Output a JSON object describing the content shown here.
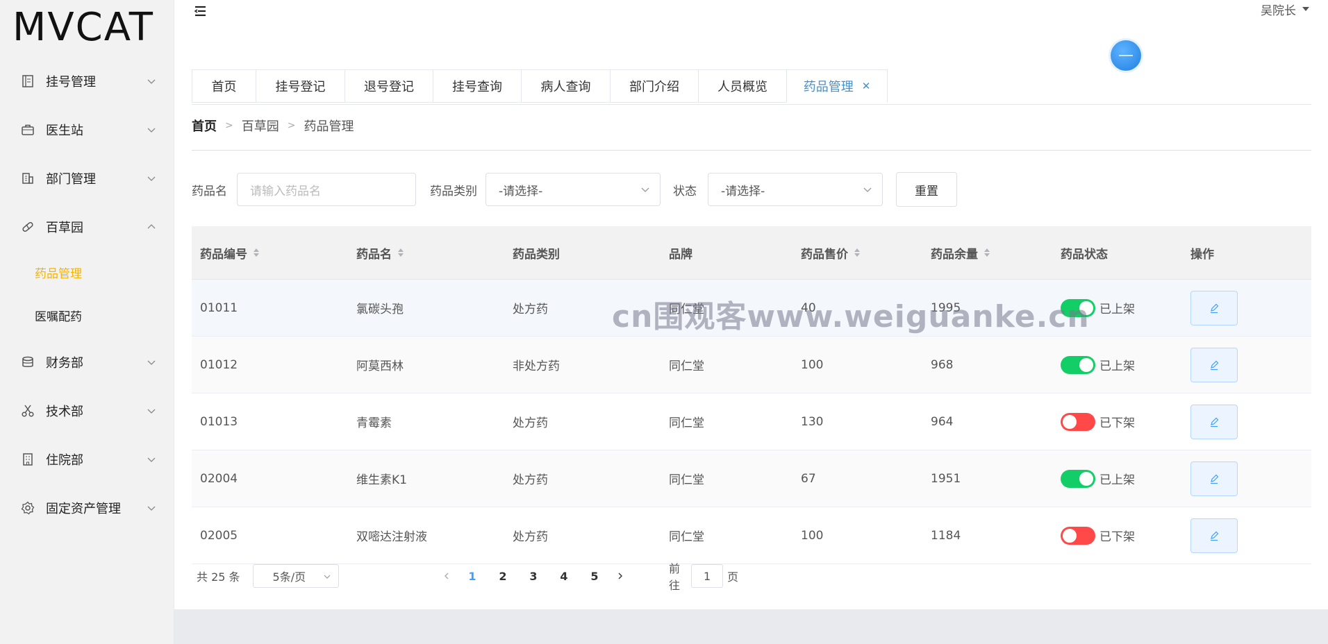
{
  "logo": "MVCAT",
  "sidebar": {
    "items": [
      {
        "label": "挂号管理",
        "icon": "document-icon"
      },
      {
        "label": "医生站",
        "icon": "briefcase-icon"
      },
      {
        "label": "部门管理",
        "icon": "building-icon"
      },
      {
        "label": "百草园",
        "icon": "medicine-icon",
        "expanded": true,
        "children": [
          {
            "label": "药品管理",
            "active": true
          },
          {
            "label": "医嘱配药"
          }
        ]
      },
      {
        "label": "财务部",
        "icon": "coins-icon"
      },
      {
        "label": "技术部",
        "icon": "scissors-icon"
      },
      {
        "label": "住院部",
        "icon": "hospital-icon"
      },
      {
        "label": "固定资产管理",
        "icon": "gear-icon"
      }
    ]
  },
  "header": {
    "user": "吴院长"
  },
  "tabs": [
    {
      "label": "首页"
    },
    {
      "label": "挂号登记"
    },
    {
      "label": "退号登记"
    },
    {
      "label": "挂号查询"
    },
    {
      "label": "病人查询"
    },
    {
      "label": "部门介绍"
    },
    {
      "label": "人员概览"
    },
    {
      "label": "药品管理",
      "active": true,
      "closable": true
    }
  ],
  "breadcrumb": [
    "首页",
    "百草园",
    "药品管理"
  ],
  "filters": {
    "name_label": "药品名",
    "name_placeholder": "请输入药品名",
    "category_label": "药品类别",
    "category_value": "-请选择-",
    "status_label": "状态",
    "status_value": "-请选择-",
    "reset_label": "重置"
  },
  "table": {
    "headers": [
      "药品编号",
      "药品名",
      "药品类别",
      "品牌",
      "药品售价",
      "药品余量",
      "药品状态",
      "操作"
    ],
    "rows": [
      {
        "id": "01011",
        "name": "氯碳头孢",
        "category": "处方药",
        "brand": "同仁堂",
        "price": "40",
        "stock": "1995",
        "on": true,
        "status": "已上架"
      },
      {
        "id": "01012",
        "name": "阿莫西林",
        "category": "非处方药",
        "brand": "同仁堂",
        "price": "100",
        "stock": "968",
        "on": true,
        "status": "已上架"
      },
      {
        "id": "01013",
        "name": "青霉素",
        "category": "处方药",
        "brand": "同仁堂",
        "price": "130",
        "stock": "964",
        "on": false,
        "status": "已下架"
      },
      {
        "id": "02004",
        "name": "维生素K1",
        "category": "处方药",
        "brand": "同仁堂",
        "price": "67",
        "stock": "1951",
        "on": true,
        "status": "已上架"
      },
      {
        "id": "02005",
        "name": "双嘧达注射液",
        "category": "处方药",
        "brand": "同仁堂",
        "price": "100",
        "stock": "1184",
        "on": false,
        "status": "已下架"
      }
    ]
  },
  "pagination": {
    "total": "共 25 条",
    "page_size": "5条/页",
    "pages": [
      "1",
      "2",
      "3",
      "4",
      "5"
    ],
    "current": "1",
    "goto_prefix": "前往",
    "goto_value": "1",
    "goto_suffix": "页"
  },
  "watermark": "cn围观客www.weiguanke.cn",
  "colors": {
    "accent": "#f5b400",
    "tab_active": "#4a90c8",
    "switch_on": "#13ce66",
    "switch_off": "#ff4949",
    "page_active": "#409eff"
  }
}
